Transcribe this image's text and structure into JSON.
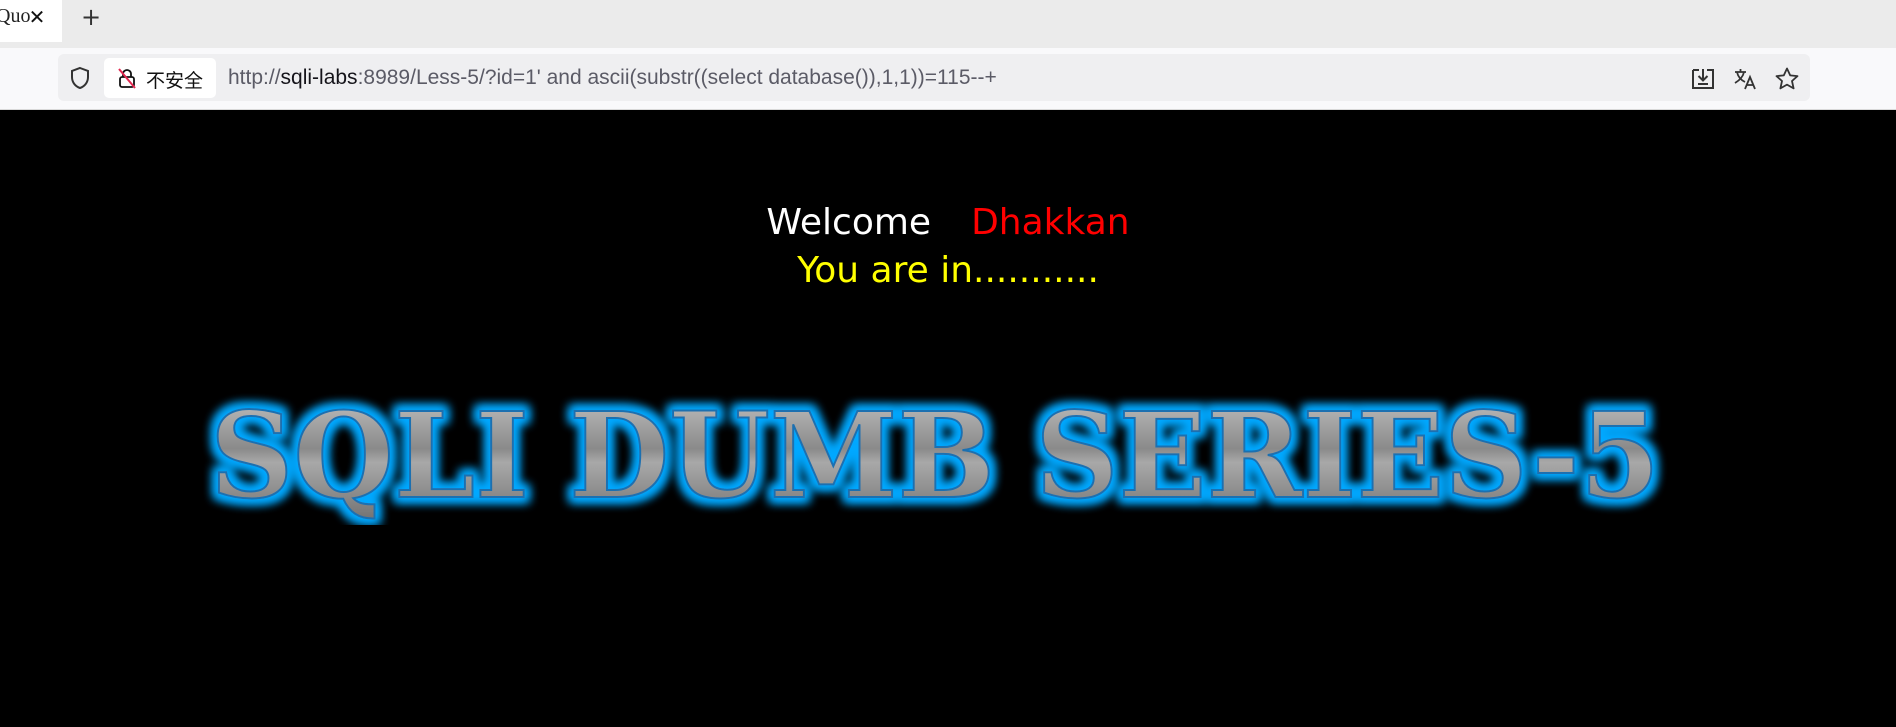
{
  "browser": {
    "tab": {
      "title": "Quo",
      "close_icon": "close-icon"
    },
    "new_tab_icon": "plus-icon",
    "urlbar": {
      "security_label": "不安全",
      "url_scheme": "http://",
      "url_host": "sqli-labs",
      "url_rest": ":8989/Less-5/?id=1' and ascii(substr((select database()),1,1))=115--+"
    },
    "icons": [
      "shield-icon",
      "insecure-lock-icon",
      "download-icon",
      "translate-icon",
      "bookmark-star-icon"
    ]
  },
  "page": {
    "welcome": "Welcome",
    "name": "Dhakkan",
    "status": "You are in...........",
    "banner_text": "SQLI DUMB SERIES-5",
    "colors": {
      "background": "#000000",
      "welcome": "#ffffff",
      "name": "#ff0000",
      "status": "#ffff00",
      "banner_glow": "#00a8ff",
      "banner_fill": "#9a9a9a"
    }
  }
}
